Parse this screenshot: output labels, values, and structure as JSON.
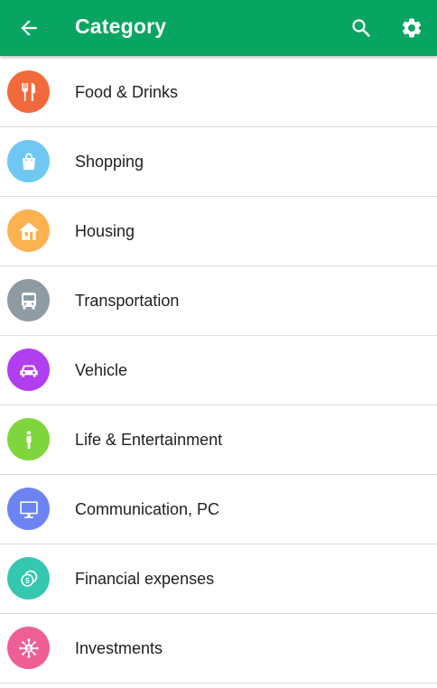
{
  "appbar": {
    "title": "Category",
    "color": "#07a561"
  },
  "categories": [
    {
      "label": "Food & Drinks",
      "icon": "fork-knife-icon",
      "color": "#f26a3b"
    },
    {
      "label": "Shopping",
      "icon": "shopping-bag-icon",
      "color": "#6fc8f2"
    },
    {
      "label": "Housing",
      "icon": "house-icon",
      "color": "#fbb24f"
    },
    {
      "label": "Transportation",
      "icon": "bus-icon",
      "color": "#8e9ba3"
    },
    {
      "label": "Vehicle",
      "icon": "car-icon",
      "color": "#b13ef0"
    },
    {
      "label": "Life & Entertainment",
      "icon": "person-icon",
      "color": "#7fd53c"
    },
    {
      "label": "Communication, PC",
      "icon": "monitor-icon",
      "color": "#6c84f2"
    },
    {
      "label": "Financial expenses",
      "icon": "coins-icon",
      "color": "#36c7b1"
    },
    {
      "label": "Investments",
      "icon": "investment-icon",
      "color": "#ef5e95"
    }
  ]
}
